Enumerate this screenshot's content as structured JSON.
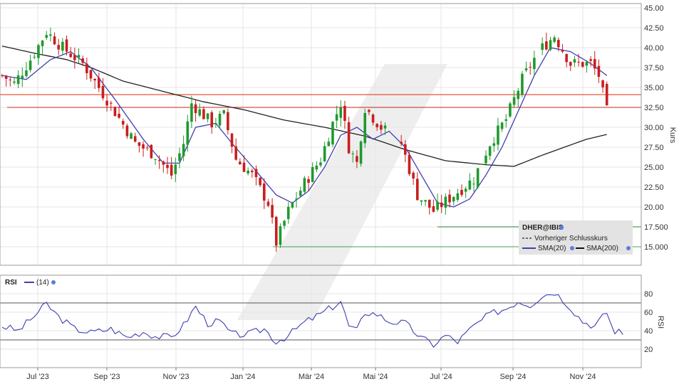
{
  "chart_data": [
    {
      "type": "candlestick",
      "title": "",
      "ylabel": "Kurs",
      "ylim": [
        12.5,
        46.0
      ],
      "y_ticks": [
        "15.000",
        "17.500",
        "20.00",
        "22.50",
        "25.00",
        "27.50",
        "30.00",
        "32.50",
        "35.00",
        "37.50",
        "40.00",
        "42.50",
        "45.00"
      ],
      "y_tick_values": [
        15,
        17.5,
        20,
        22.5,
        25,
        27.5,
        30,
        32.5,
        35,
        37.5,
        40,
        42.5,
        45
      ],
      "x_ticks": [
        "Jul '23",
        "Sep '23",
        "Nov '23",
        "Jan '24",
        "Mär '24",
        "Mai '24",
        "Jul '24",
        "Sep '24",
        "Nov '24"
      ],
      "grid": true,
      "legend_position": "bottom-right",
      "legend": {
        "symbol": "DHER@IBIS",
        "prev_close": "Vorheriger Schlusskurs",
        "sma20": "SMA(20)",
        "sma200": "SMA(200)"
      },
      "price_series_anchors": [
        [
          0,
          36.5
        ],
        [
          3,
          35.5
        ],
        [
          7,
          38.5
        ],
        [
          11,
          42.0
        ],
        [
          15,
          40.0
        ],
        [
          20,
          38.0
        ],
        [
          26,
          33.5
        ],
        [
          33,
          28.0
        ],
        [
          38,
          26.5
        ],
        [
          42,
          24.0
        ],
        [
          45,
          28.0
        ],
        [
          47,
          33.0
        ],
        [
          52,
          30.5
        ],
        [
          55,
          31.5
        ],
        [
          58,
          26.0
        ],
        [
          62,
          24.0
        ],
        [
          66,
          20.5
        ],
        [
          68,
          15.5
        ],
        [
          71,
          19.5
        ],
        [
          75,
          23.0
        ],
        [
          79,
          26.0
        ],
        [
          82,
          30.5
        ],
        [
          84,
          33.0
        ],
        [
          86,
          27.5
        ],
        [
          88,
          25.5
        ],
        [
          90,
          32.5
        ],
        [
          94,
          30.0
        ],
        [
          99,
          28.0
        ],
        [
          103,
          21.5
        ],
        [
          107,
          19.5
        ],
        [
          112,
          21.5
        ],
        [
          117,
          23.5
        ],
        [
          121,
          28.0
        ],
        [
          125,
          31.0
        ],
        [
          129,
          36.0
        ],
        [
          133,
          39.5
        ],
        [
          137,
          41.5
        ],
        [
          141,
          38.0
        ],
        [
          146,
          38.0
        ],
        [
          148,
          36.5
        ],
        [
          150,
          32.0
        ]
      ],
      "sma20_anchors": [
        [
          0,
          36.5
        ],
        [
          6,
          36.0
        ],
        [
          12,
          38.5
        ],
        [
          17,
          39.5
        ],
        [
          22,
          37.5
        ],
        [
          28,
          33.5
        ],
        [
          35,
          28.5
        ],
        [
          40,
          25.5
        ],
        [
          44,
          25.5
        ],
        [
          48,
          30.0
        ],
        [
          53,
          30.5
        ],
        [
          57,
          28.0
        ],
        [
          63,
          24.5
        ],
        [
          68,
          21.5
        ],
        [
          72,
          20.5
        ],
        [
          76,
          22.0
        ],
        [
          80,
          25.0
        ],
        [
          84,
          29.0
        ],
        [
          88,
          30.0
        ],
        [
          92,
          28.5
        ],
        [
          96,
          29.5
        ],
        [
          100,
          27.5
        ],
        [
          104,
          24.0
        ],
        [
          108,
          20.5
        ],
        [
          112,
          20.0
        ],
        [
          116,
          21.0
        ],
        [
          120,
          24.0
        ],
        [
          124,
          27.5
        ],
        [
          128,
          32.0
        ],
        [
          132,
          36.5
        ],
        [
          136,
          40.0
        ],
        [
          141,
          39.5
        ],
        [
          146,
          38.0
        ],
        [
          150,
          36.5
        ]
      ],
      "sma200_anchors": [
        [
          0,
          40.2
        ],
        [
          8,
          39.3
        ],
        [
          16,
          38.5
        ],
        [
          22,
          37.5
        ],
        [
          30,
          35.8
        ],
        [
          40,
          34.5
        ],
        [
          50,
          33.2
        ],
        [
          60,
          32.2
        ],
        [
          70,
          30.9
        ],
        [
          80,
          30.0
        ],
        [
          90,
          28.9
        ],
        [
          100,
          27.2
        ],
        [
          110,
          25.8
        ],
        [
          120,
          25.3
        ],
        [
          127,
          25.1
        ],
        [
          134,
          26.5
        ],
        [
          140,
          27.6
        ],
        [
          145,
          28.5
        ],
        [
          150,
          29.1
        ]
      ],
      "horizontal_lines": [
        {
          "value": 34.1,
          "color": "#e8401f"
        },
        {
          "value": 32.5,
          "color": "#c0281c"
        },
        {
          "value": 17.5,
          "color": "#2e7d32"
        },
        {
          "value": 15.0,
          "color": "#43a047"
        }
      ],
      "gap_ranges": [
        [
          96,
          98
        ],
        [
          133,
          133
        ]
      ]
    },
    {
      "type": "line",
      "title": "",
      "ylabel": "RSI",
      "label": "RSI",
      "param": "(14)",
      "ylim": [
        12,
        90
      ],
      "y_ticks": [
        "20",
        "40",
        "60",
        "80"
      ],
      "y_tick_values": [
        20,
        40,
        60,
        80
      ],
      "reference_lines": [
        70,
        30
      ],
      "series_anchors": [
        [
          0,
          45
        ],
        [
          4,
          40
        ],
        [
          8,
          56
        ],
        [
          11,
          69
        ],
        [
          14,
          55
        ],
        [
          18,
          42
        ],
        [
          22,
          38
        ],
        [
          27,
          42
        ],
        [
          31,
          33
        ],
        [
          35,
          39
        ],
        [
          38,
          34
        ],
        [
          42,
          33
        ],
        [
          45,
          46
        ],
        [
          48,
          66
        ],
        [
          51,
          48
        ],
        [
          54,
          50
        ],
        [
          57,
          36
        ],
        [
          61,
          36
        ],
        [
          65,
          42
        ],
        [
          68,
          28
        ],
        [
          71,
          35
        ],
        [
          75,
          49
        ],
        [
          79,
          58
        ],
        [
          82,
          66
        ],
        [
          84,
          72
        ],
        [
          86,
          45
        ],
        [
          88,
          40
        ],
        [
          90,
          60
        ],
        [
          93,
          58
        ],
        [
          96,
          50
        ],
        [
          100,
          48
        ],
        [
          104,
          32
        ],
        [
          107,
          25
        ],
        [
          110,
          35
        ],
        [
          113,
          28
        ],
        [
          117,
          45
        ],
        [
          121,
          58
        ],
        [
          125,
          64
        ],
        [
          128,
          72
        ],
        [
          131,
          68
        ],
        [
          134,
          78
        ],
        [
          137,
          82
        ],
        [
          140,
          70
        ],
        [
          144,
          50
        ],
        [
          147,
          45
        ],
        [
          150,
          60
        ],
        [
          152,
          36
        ],
        [
          153,
          45
        ],
        [
          154,
          33
        ]
      ]
    }
  ]
}
